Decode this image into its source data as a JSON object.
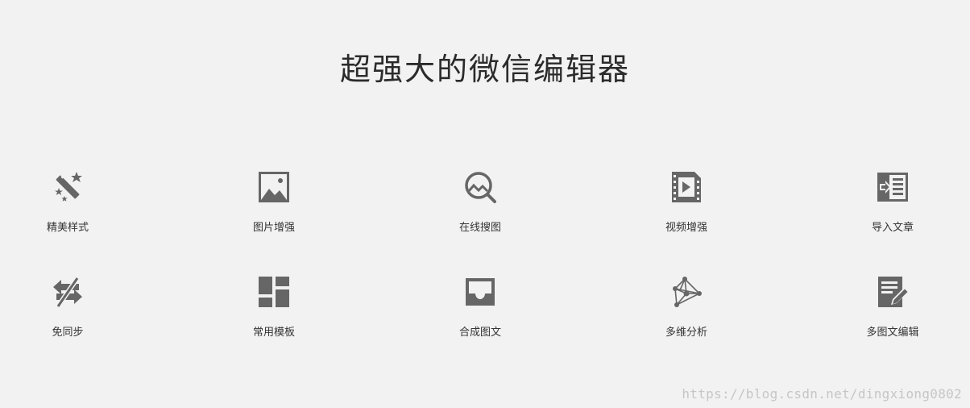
{
  "page": {
    "title": "超强大的微信编辑器"
  },
  "features": {
    "row1": [
      {
        "label": "精美样式",
        "icon": "magic-wand-icon"
      },
      {
        "label": "图片增强",
        "icon": "image-icon"
      },
      {
        "label": "在线搜图",
        "icon": "image-search-icon"
      },
      {
        "label": "视频增强",
        "icon": "video-icon"
      },
      {
        "label": "导入文章",
        "icon": "import-article-icon"
      }
    ],
    "row2": [
      {
        "label": "免同步",
        "icon": "sync-disabled-icon"
      },
      {
        "label": "常用模板",
        "icon": "template-dashboard-icon"
      },
      {
        "label": "合成图文",
        "icon": "inbox-tray-icon"
      },
      {
        "label": "多维分析",
        "icon": "network-analysis-icon"
      },
      {
        "label": "多图文编辑",
        "icon": "document-edit-icon"
      }
    ]
  },
  "watermark": "https://blog.csdn.net/dingxiong0802",
  "colors": {
    "background": "#f2f2f2",
    "icon": "#666666",
    "title": "#2b2b2b"
  }
}
